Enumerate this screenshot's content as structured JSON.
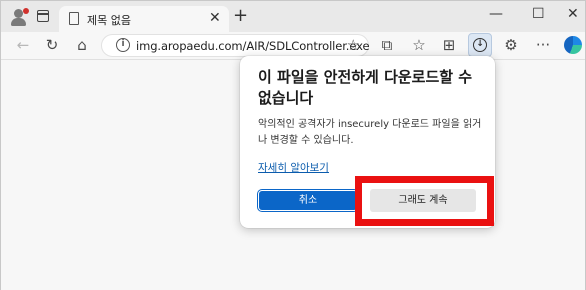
{
  "tab": {
    "title": "제목 없음",
    "close": "✕",
    "new": "+"
  },
  "window_controls": {
    "minimize": "—",
    "maximize": "☐",
    "close": "✕"
  },
  "toolbar": {
    "back": "←",
    "refresh": "↻",
    "home": "⌂",
    "url": "img.aropaedu.com/AIR/SDLController.exe",
    "info": "i",
    "favorite": "☆",
    "read": "⧉",
    "favorites": "☆",
    "collections": "⊞",
    "download": "↓",
    "extensions": "⚙",
    "more": "···"
  },
  "dialog": {
    "title": "이 파일을 안전하게 다운로드할 수 없습니다",
    "message": "악의적인 공격자가 insecurely 다운로드 파일을 읽거나 변경할 수 있습니다.",
    "learn_more": "자세히 알아보기",
    "cancel_label": "취소",
    "continue_label": "그래도 계속"
  },
  "colors": {
    "highlight": "#ea1111",
    "primary": "#0b66c8",
    "link": "#0b5cad"
  }
}
